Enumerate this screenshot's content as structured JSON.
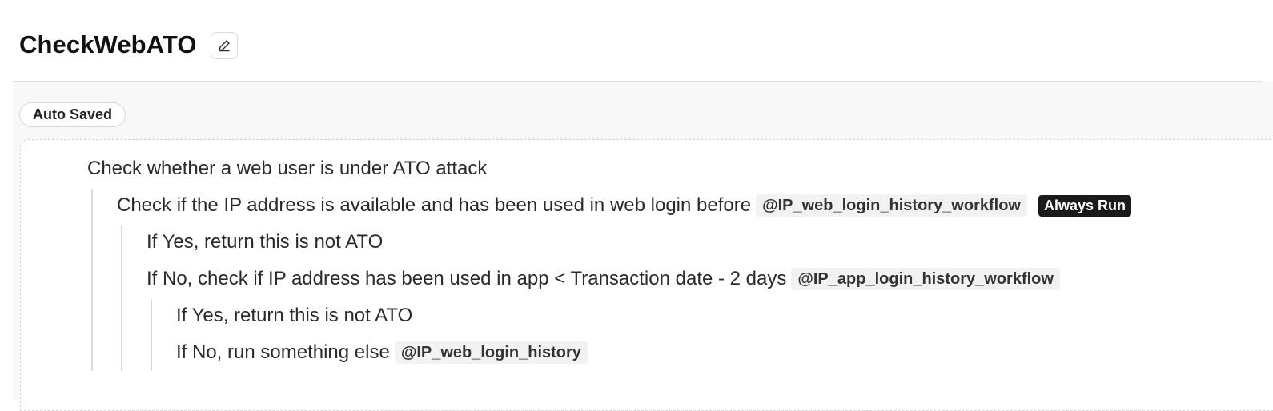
{
  "header": {
    "title": "CheckWebATO",
    "edit_icon": "pencil-icon"
  },
  "status": {
    "badge": "Auto Saved"
  },
  "tree": [
    {
      "text": "Check whether a web user is under ATO attack",
      "depth": 0
    },
    {
      "text": "Check if the IP address is available and has been used in web login before",
      "ref": "@IP_web_login_history_workflow",
      "tag": "Always Run",
      "depth": 1
    },
    {
      "text": "If Yes, return this is not ATO",
      "depth": 2
    },
    {
      "text": "If No, check if IP address has been used in app < Transaction date - 2 days",
      "ref": "@IP_app_login_history_workflow",
      "depth": 2
    },
    {
      "text": "If Yes, return this is not ATO",
      "depth": 3
    },
    {
      "text": "If No, run something else",
      "ref": "@IP_web_login_history",
      "depth": 3
    }
  ]
}
